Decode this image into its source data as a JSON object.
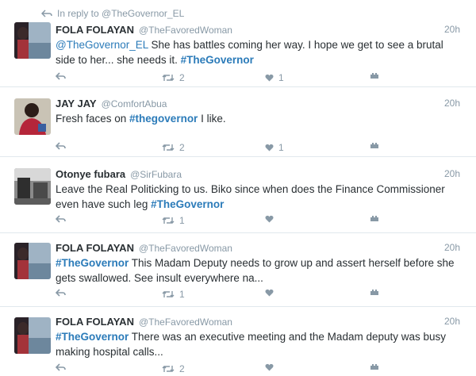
{
  "tweets": [
    {
      "reply_context": "In reply to @TheGovernor_EL",
      "name": "FOLA FOLAYAN",
      "handle": "@TheFavoredWoman",
      "time": "20h",
      "text_parts": [
        {
          "t": "@TheGovernor_EL",
          "k": "link"
        },
        {
          "t": " She has battles coming her way. I hope we get to see a brutal side to her... she needs it. ",
          "k": "plain"
        },
        {
          "t": "#TheGovernor",
          "k": "hashtag"
        }
      ],
      "retweets": "2",
      "likes": "1",
      "avatar": "woman-by-water-photo"
    },
    {
      "name": "JAY JAY",
      "handle": "@ComfortAbua",
      "time": "20h",
      "text_parts": [
        {
          "t": "Fresh faces on ",
          "k": "plain"
        },
        {
          "t": "#thegovernor",
          "k": "hashtag"
        },
        {
          "t": " I like.",
          "k": "plain"
        }
      ],
      "retweets": "2",
      "likes": "1",
      "avatar": "woman-red-outfit-photo"
    },
    {
      "name": "Otonye fubara",
      "handle": "@SirFubara",
      "time": "20h",
      "text_parts": [
        {
          "t": "Leave the Real Politicking to us. Biko since when does the Finance Commissioner even have such leg ",
          "k": "plain"
        },
        {
          "t": "#TheGovernor",
          "k": "hashtag"
        }
      ],
      "retweets": "1",
      "likes": "",
      "avatar": "grayscale-room-photo"
    },
    {
      "name": "FOLA FOLAYAN",
      "handle": "@TheFavoredWoman",
      "time": "20h",
      "text_parts": [
        {
          "t": "#TheGovernor",
          "k": "hashtag"
        },
        {
          "t": " This Madam Deputy needs to grow up and assert herself before she gets swallowed. See insult everywhere na...",
          "k": "plain"
        }
      ],
      "retweets": "1",
      "likes": "",
      "avatar": "woman-by-water-photo"
    },
    {
      "name": "FOLA FOLAYAN",
      "handle": "@TheFavoredWoman",
      "time": "20h",
      "text_parts": [
        {
          "t": "#TheGovernor",
          "k": "hashtag"
        },
        {
          "t": " There was an executive meeting and the Madam deputy was busy making hospital calls...",
          "k": "plain"
        }
      ],
      "retweets": "2",
      "likes": "",
      "avatar": "woman-by-water-photo"
    }
  ],
  "colors": {
    "link": "#2b7bb9",
    "meta": "#8899a6",
    "text": "#292f33",
    "divider": "#e1e8ed"
  },
  "icons": [
    "reply-arrow-icon",
    "reply-icon",
    "retweet-icon",
    "like-icon",
    "more-icon"
  ]
}
